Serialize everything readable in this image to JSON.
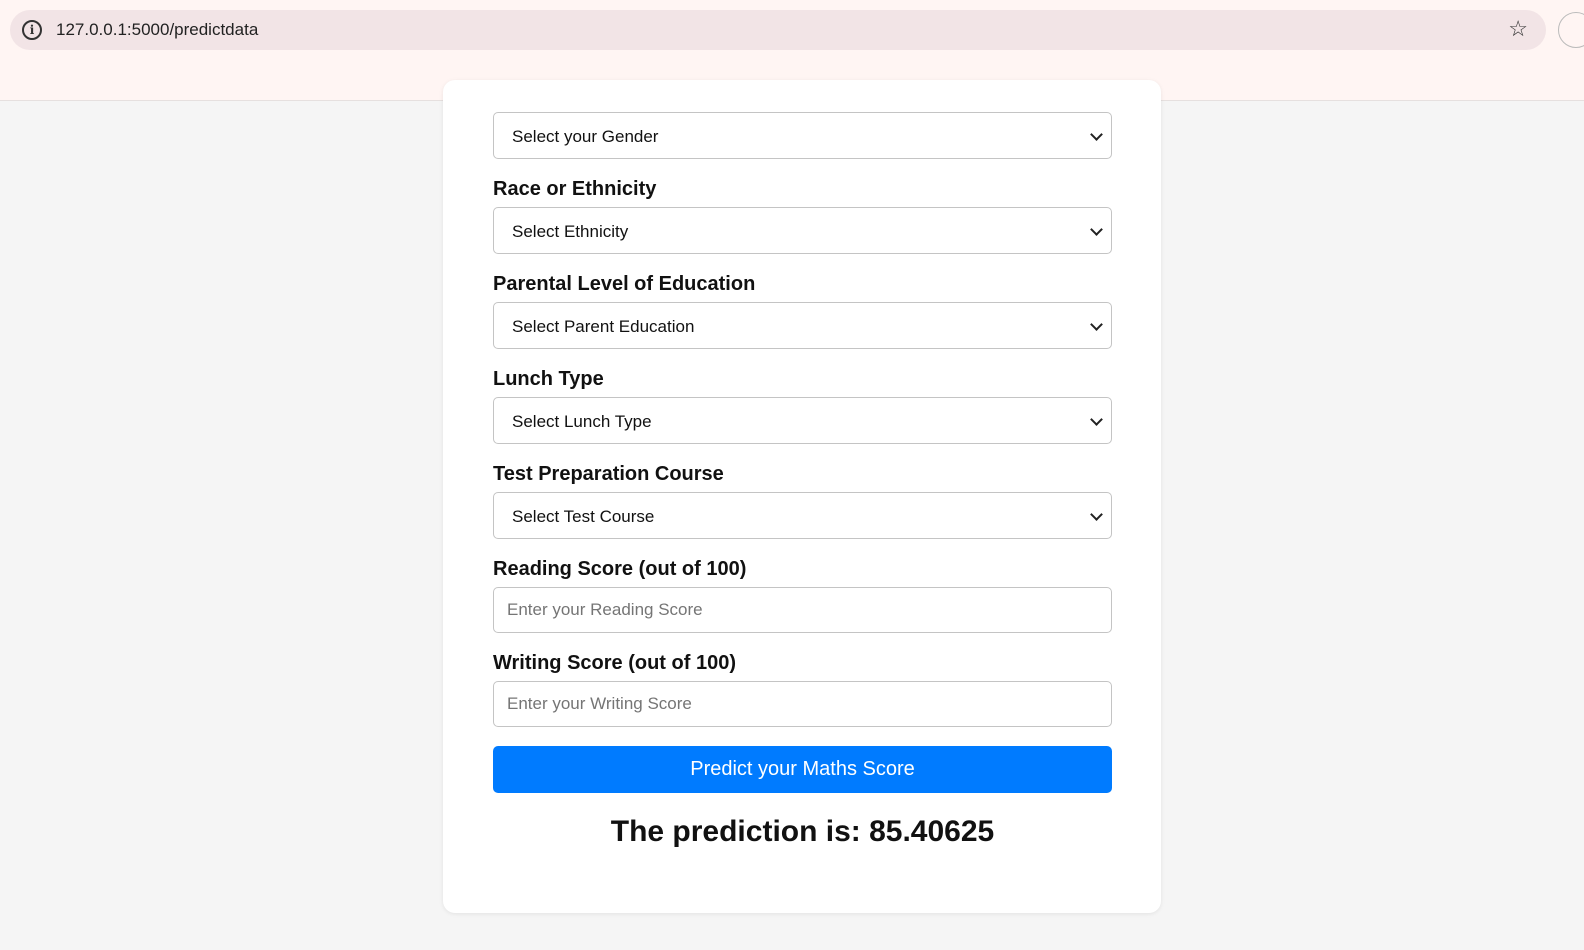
{
  "browser": {
    "url": "127.0.0.1:5000/predictdata",
    "info_icon": "i",
    "bookmark_icon": "☆"
  },
  "form": {
    "gender": {
      "selected": "Select your Gender"
    },
    "ethnicity": {
      "label": "Race or Ethnicity",
      "selected": "Select Ethnicity"
    },
    "parent_education": {
      "label": "Parental Level of Education",
      "selected": "Select Parent Education"
    },
    "lunch": {
      "label": "Lunch Type",
      "selected": "Select Lunch Type"
    },
    "test_course": {
      "label": "Test Preparation Course",
      "selected": "Select Test Course"
    },
    "reading": {
      "label": "Reading Score (out of 100)",
      "placeholder": "Enter your Reading Score"
    },
    "writing": {
      "label": "Writing Score (out of 100)",
      "placeholder": "Enter your Writing Score"
    },
    "submit_label": "Predict your Maths Score"
  },
  "result": {
    "text": "The prediction is: 85.40625"
  },
  "colors": {
    "primary_button": "#007bff",
    "page_background": "#f5f5f5",
    "chrome_background": "#fff5f3"
  }
}
